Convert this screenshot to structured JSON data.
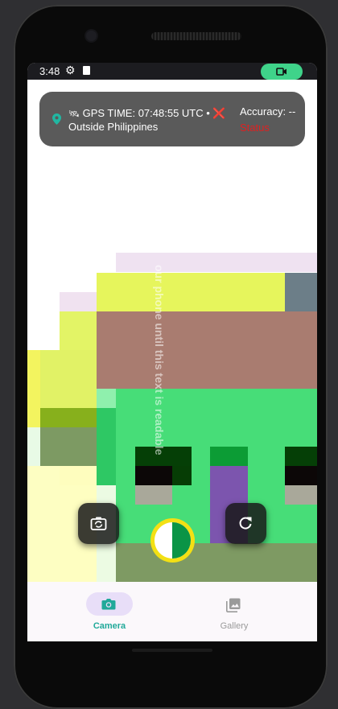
{
  "status_bar": {
    "time": "3:48",
    "gear_icon": "gear-icon",
    "sd_icon": "sd-card-icon",
    "record_icon": "videocam-icon",
    "record_color": "#3fd38a"
  },
  "gps_card": {
    "gps_text": "GPS TIME: 07:48:55 UTC •",
    "location_text": "Outside Philippines",
    "accuracy_label": "Accuracy: --",
    "status_label": "Status",
    "status_color": "#e02020",
    "satellite_emoji": "🛰",
    "error_mark": "❌"
  },
  "viewfinder": {
    "overlay_text": "our phone until this text is readable"
  },
  "controls": {
    "switch_camera_icon": "switch-camera-icon",
    "shutter_icon": "shutter-icon",
    "refresh_icon": "refresh-icon",
    "shutter_ring_color": "#f3e014",
    "shutter_fill_color": "#0b9446"
  },
  "bottom_nav": {
    "items": [
      {
        "label": "Camera",
        "icon": "camera-icon",
        "active": true,
        "color": "#21a99a"
      },
      {
        "label": "Gallery",
        "icon": "gallery-icon",
        "active": false,
        "color": "#9a9a9a"
      }
    ]
  }
}
